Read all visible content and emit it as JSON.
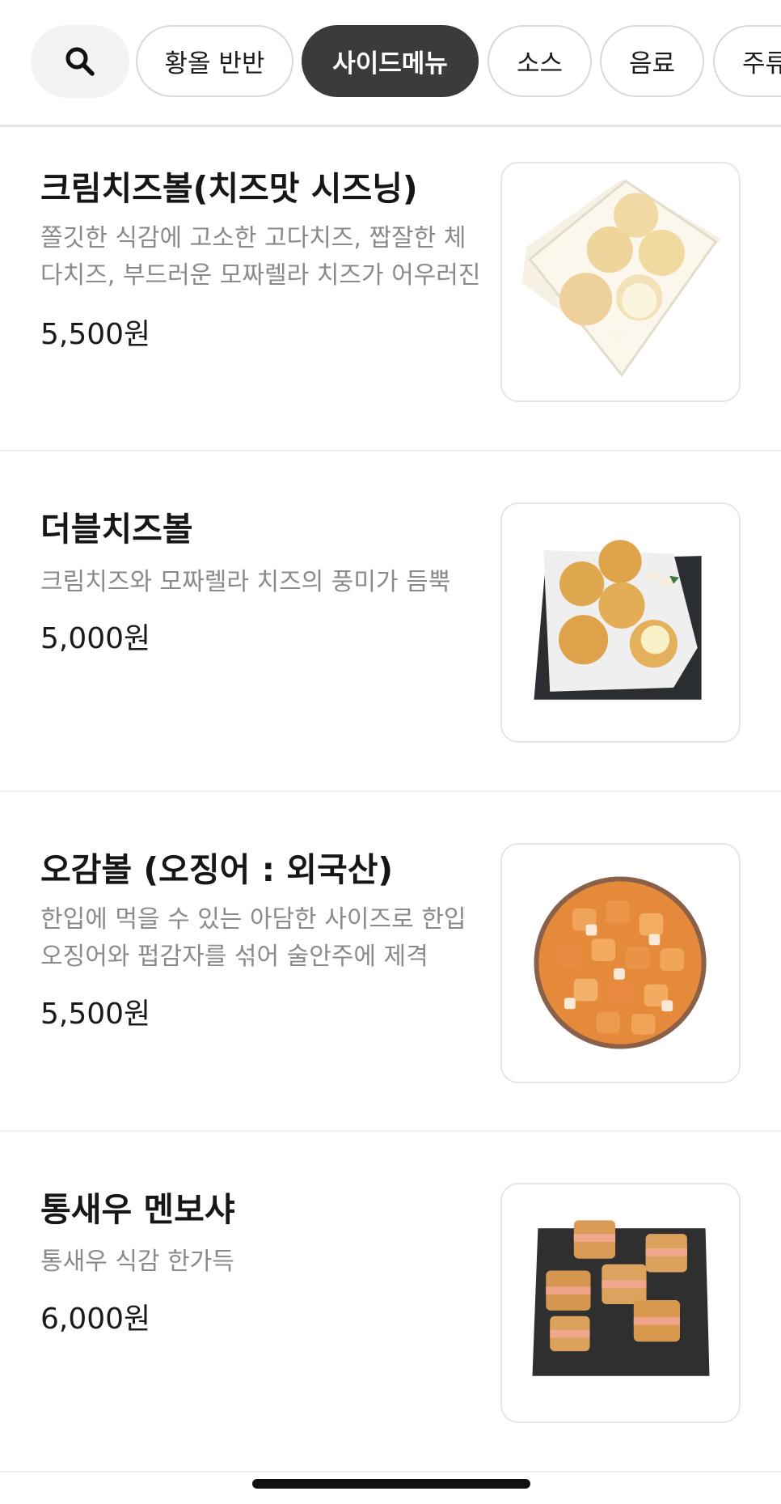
{
  "categories": {
    "search_icon": "search-icon",
    "chips": [
      "황올 반반",
      "사이드메뉴",
      "소스",
      "음료",
      "주류"
    ],
    "active_index": 1
  },
  "items": [
    {
      "name": "크림치즈볼(치즈맛 시즈닝)",
      "description": "쫄깃한 식감에 고소한 고다치즈, 짭잘한 체다치즈, 부드러운 모짜렐라 치즈가 어우러진",
      "price": "5,500원",
      "image": "cheese-balls-tray-image"
    },
    {
      "name": "더블치즈볼",
      "description": "크림치즈와 모짜렐라 치즈의 풍미가 듬뿍",
      "price": "5,000원",
      "image": "double-cheese-balls-image"
    },
    {
      "name": "오감볼 (오징어 : 외국산)",
      "description": "한입에 먹을 수 있는 아담한 사이즈로 한입오징어와 펍감자를 섞어 술안주에 제격",
      "price": "5,500원",
      "image": "squid-potato-bowl-image"
    },
    {
      "name": "통새우 멘보샤",
      "description": "통새우 식감 한가득",
      "price": "6,000원",
      "image": "shrimp-menbosha-image"
    }
  ],
  "colors": {
    "active_chip": "#3b3b3b",
    "description_text": "#8a8a8a",
    "divider": "#efefef"
  }
}
